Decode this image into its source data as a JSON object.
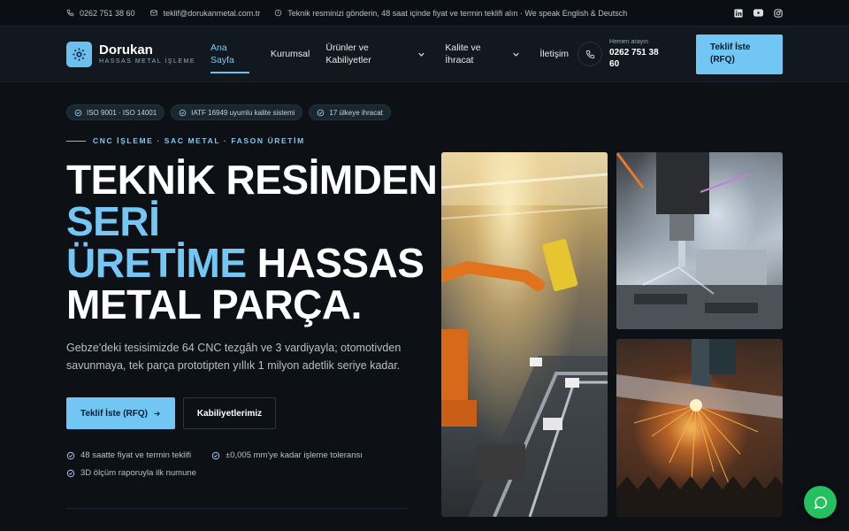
{
  "topbar": {
    "phone": "0262 751 38 60",
    "email": "teklif@dorukanmetal.com.tr",
    "notice": "Teknik resminizi gönderin, 48 saat içinde fiyat ve termin teklifi alın · We speak English & Deutsch",
    "socials": [
      "linkedin-icon",
      "youtube-icon",
      "instagram-icon"
    ]
  },
  "header": {
    "brand": "Dorukan",
    "tagline": "HASSAS METAL İŞLEME",
    "nav": [
      {
        "label": "Ana Sayfa",
        "active": true
      },
      {
        "label": "Kurumsal"
      },
      {
        "label": "Ürünler ve Kabiliyetler",
        "dropdown": true
      },
      {
        "label": "Kalite ve İhracat",
        "dropdown": true
      },
      {
        "label": "İletişim"
      }
    ],
    "call_label": "Hemen arayın",
    "call_number": "0262 751 38 60",
    "rfq_label": "Teklif İste (RFQ)"
  },
  "hero": {
    "badges": [
      "ISO 9001 · ISO 14001",
      "IATF 16949 uyumlu kalite sistemi",
      "17 ülkeye ihracat"
    ],
    "eyebrow": "CNC İŞLEME · SAC METAL · FASON ÜRETİM",
    "headline": {
      "part1": "TEKNİK RESİMDEN ",
      "highlight1": "SERİ",
      "highlight2": "ÜRETİME",
      "part2": " HASSAS METAL PARÇA."
    },
    "description": "Gebze'deki tesisimizde 64 CNC tezgâh ve 3 vardiyayla; otomotivden savunmaya, tek parça prototipten yıllık 1 milyon adetlik seriye kadar.",
    "cta_primary": "Teklif İste (RFQ)",
    "cta_secondary": "Kabiliyetlerimiz",
    "checks": [
      "48 saatte fiyat ve termin teklifi",
      "±0,005 mm'ye kadar işleme toleransı",
      "3D ölçüm raporuyla ilk numune"
    ]
  },
  "colors": {
    "accent": "#72c6f4",
    "background": "#0d1014",
    "whatsapp": "#25c060"
  }
}
